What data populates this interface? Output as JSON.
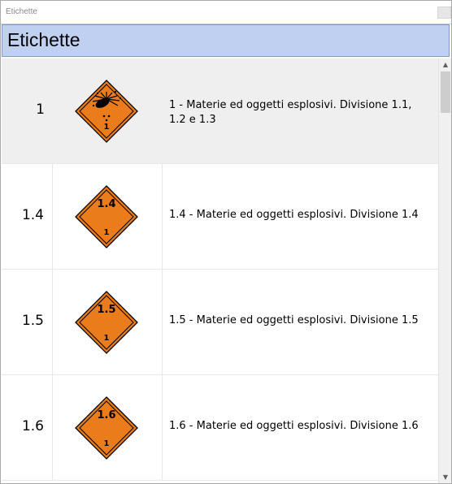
{
  "window": {
    "title": "Etichette"
  },
  "header": {
    "title": "Etichette"
  },
  "colors": {
    "placard_fill": "#ea7c1c",
    "placard_border": "#000000",
    "header_bg": "#c0d0f1",
    "selected_row_bg": "#efefef"
  },
  "rows": [
    {
      "number": "1",
      "icon": "explosive-bomb-icon",
      "description": "1 - Materie ed oggetti esplosivi. Divisione 1.1, 1.2 e 1.3"
    },
    {
      "number": "1.4",
      "icon": "explosive-1-4-placard-icon",
      "placard_text": "1.4",
      "description": "1.4 - Materie ed oggetti esplosivi. Divisione 1.4"
    },
    {
      "number": "1.5",
      "icon": "explosive-1-5-placard-icon",
      "placard_text": "1.5",
      "description": "1.5 - Materie ed oggetti esplosivi. Divisione 1.5"
    },
    {
      "number": "1.6",
      "icon": "explosive-1-6-placard-icon",
      "placard_text": "1.6",
      "description": "1.6 - Materie ed oggetti esplosivi. Divisione 1.6"
    }
  ],
  "placard_bottom_text": "1",
  "scrollbar": {
    "up_icon": "scroll-up-arrow-icon",
    "down_icon": "scroll-down-arrow-icon"
  }
}
